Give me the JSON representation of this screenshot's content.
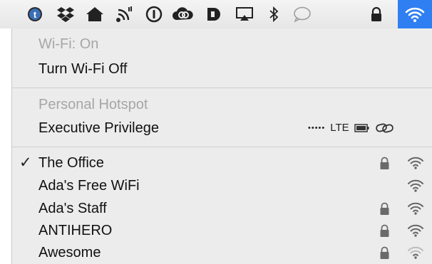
{
  "menubar": {
    "icons": [
      "tumblr-icon",
      "dropbox-icon",
      "home-icon",
      "signal-icon",
      "password-icon",
      "creative-cloud-icon",
      "d-app-icon",
      "airplay-icon",
      "bluetooth-icon",
      "messages-icon",
      "lock-icon",
      "wifi-icon"
    ]
  },
  "menu": {
    "status": "Wi-Fi: On",
    "toggle": "Turn Wi-Fi Off",
    "hotspot_header": "Personal Hotspot",
    "hotspot_name": "Executive Privilege",
    "hotspot_signal": "•••••",
    "hotspot_network": "LTE",
    "networks": [
      {
        "name": "The Office",
        "checked": true,
        "locked": true
      },
      {
        "name": "Ada's Free WiFi",
        "checked": false,
        "locked": false
      },
      {
        "name": "Ada's Staff",
        "checked": false,
        "locked": true
      },
      {
        "name": "ANTIHERO",
        "checked": false,
        "locked": true
      },
      {
        "name": "Awesome",
        "checked": false,
        "locked": true,
        "weak": true
      }
    ],
    "check_glyph": "✓"
  },
  "colors": {
    "accent": "#2f7ff2",
    "menu_bg": "#ececec",
    "disabled_text": "#a6a6a6"
  }
}
